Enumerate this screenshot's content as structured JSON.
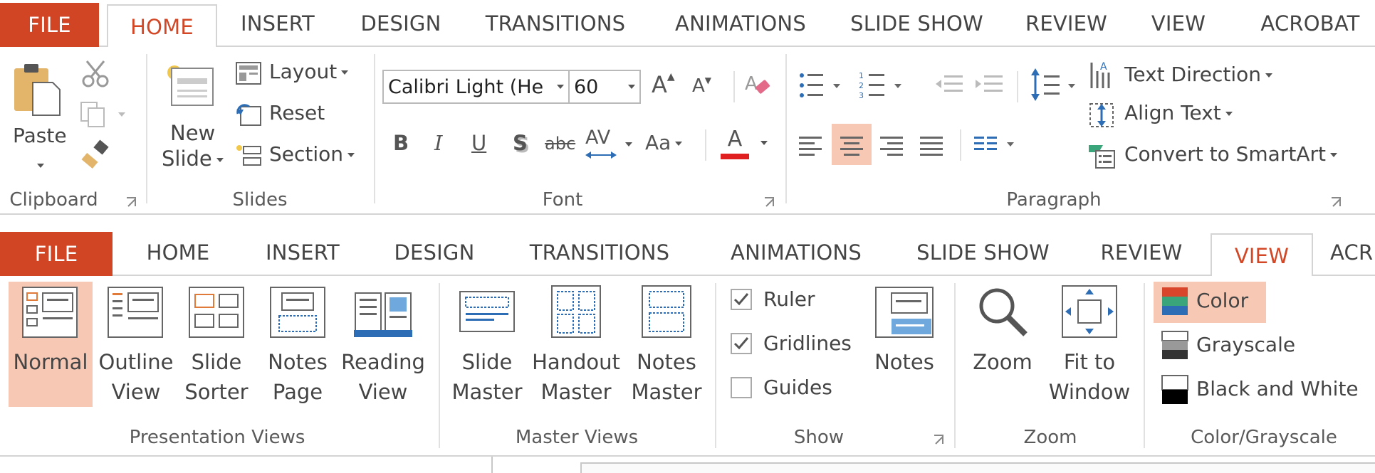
{
  "home_ribbon": {
    "tabs": [
      "FILE",
      "HOME",
      "INSERT",
      "DESIGN",
      "TRANSITIONS",
      "ANIMATIONS",
      "SLIDE SHOW",
      "REVIEW",
      "VIEW",
      "ACROBAT"
    ],
    "clipboard": {
      "paste": "Paste",
      "group": "Clipboard"
    },
    "slides": {
      "new_slide_line1": "New",
      "new_slide_line2": "Slide",
      "layout": "Layout",
      "reset": "Reset",
      "section": "Section",
      "group": "Slides"
    },
    "font": {
      "font_name": "Calibri Light (He",
      "font_size": "60",
      "bold": "B",
      "italic": "I",
      "underline": "U",
      "shadow": "S",
      "strike": "abc",
      "spacing": "AV",
      "case": "Aa",
      "color_a": "A",
      "grow": "A",
      "shrink": "A",
      "group": "Font"
    },
    "paragraph": {
      "text_direction": "Text Direction",
      "align_text": "Align Text",
      "convert_smartart": "Convert to SmartArt",
      "group": "Paragraph"
    }
  },
  "view_ribbon": {
    "tabs": [
      "FILE",
      "HOME",
      "INSERT",
      "DESIGN",
      "TRANSITIONS",
      "ANIMATIONS",
      "SLIDE SHOW",
      "REVIEW",
      "VIEW",
      "ACR"
    ],
    "presentation_views": {
      "items": [
        {
          "l1": "Normal",
          "l2": ""
        },
        {
          "l1": "Outline",
          "l2": "View"
        },
        {
          "l1": "Slide",
          "l2": "Sorter"
        },
        {
          "l1": "Notes",
          "l2": "Page"
        },
        {
          "l1": "Reading",
          "l2": "View"
        }
      ],
      "group": "Presentation Views"
    },
    "master_views": {
      "items": [
        {
          "l1": "Slide",
          "l2": "Master"
        },
        {
          "l1": "Handout",
          "l2": "Master"
        },
        {
          "l1": "Notes",
          "l2": "Master"
        }
      ],
      "group": "Master Views"
    },
    "show": {
      "ruler": "Ruler",
      "gridlines": "Gridlines",
      "guides": "Guides",
      "notes": "Notes",
      "group": "Show",
      "ruler_checked": true,
      "gridlines_checked": true,
      "guides_checked": false
    },
    "zoom": {
      "zoom": "Zoom",
      "fit_l1": "Fit to",
      "fit_l2": "Window",
      "group": "Zoom"
    },
    "color_grayscale": {
      "color": "Color",
      "grayscale": "Grayscale",
      "black_white": "Black and White",
      "group": "Color/Grayscale"
    }
  },
  "colors": {
    "file_tab": "#d14524",
    "active_tab_text": "#d24726",
    "selected_bg": "#f7c9b5",
    "font_color_bar": "#e02020"
  }
}
